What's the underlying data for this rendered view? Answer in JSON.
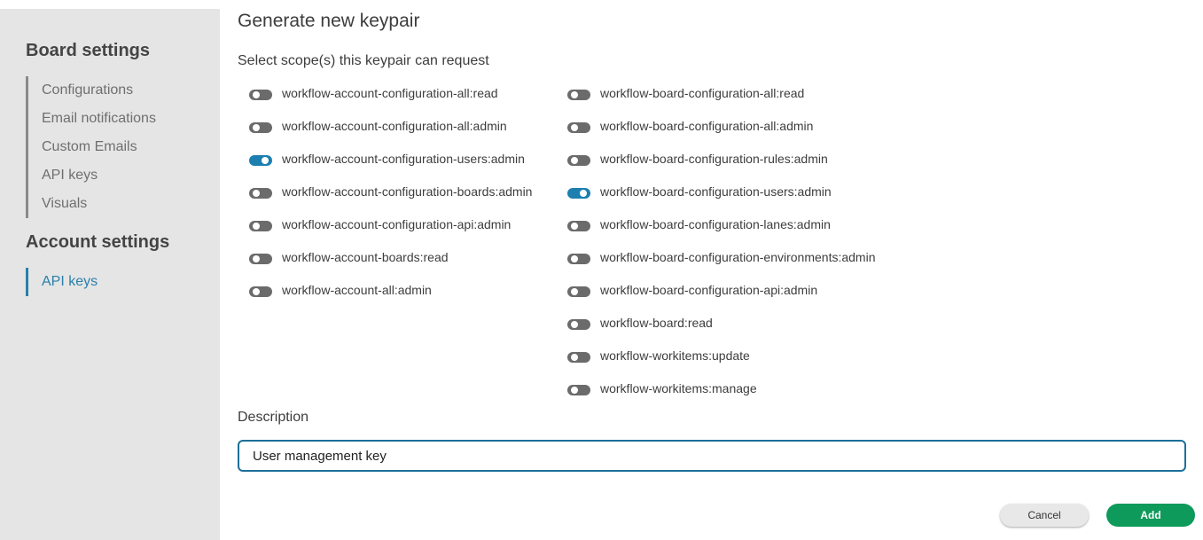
{
  "sidebar": {
    "board_heading": "Board settings",
    "board_items": [
      "Configurations",
      "Email notifications",
      "Custom Emails",
      "API keys",
      "Visuals"
    ],
    "account_heading": "Account settings",
    "account_items": [
      "API keys"
    ],
    "active_item": "API keys",
    "active_color": "#2a7fa8"
  },
  "main": {
    "title": "Generate new keypair",
    "scope_label": "Select scope(s) this keypair can request",
    "scopes_left": [
      {
        "name": "workflow-account-configuration-all:read",
        "enabled": false
      },
      {
        "name": "workflow-account-configuration-all:admin",
        "enabled": false
      },
      {
        "name": "workflow-account-configuration-users:admin",
        "enabled": true
      },
      {
        "name": "workflow-account-configuration-boards:admin",
        "enabled": false
      },
      {
        "name": "workflow-account-configuration-api:admin",
        "enabled": false
      },
      {
        "name": "workflow-account-boards:read",
        "enabled": false
      },
      {
        "name": "workflow-account-all:admin",
        "enabled": false
      }
    ],
    "scopes_right": [
      {
        "name": "workflow-board-configuration-all:read",
        "enabled": false
      },
      {
        "name": "workflow-board-configuration-all:admin",
        "enabled": false
      },
      {
        "name": "workflow-board-configuration-rules:admin",
        "enabled": false
      },
      {
        "name": "workflow-board-configuration-users:admin",
        "enabled": true
      },
      {
        "name": "workflow-board-configuration-lanes:admin",
        "enabled": false
      },
      {
        "name": "workflow-board-configuration-environments:admin",
        "enabled": false
      },
      {
        "name": "workflow-board-configuration-api:admin",
        "enabled": false
      },
      {
        "name": "workflow-board:read",
        "enabled": false
      },
      {
        "name": "workflow-workitems:update",
        "enabled": false
      },
      {
        "name": "workflow-workitems:manage",
        "enabled": false
      }
    ],
    "description_label": "Description",
    "description_value": "User management key",
    "cancel_label": "Cancel",
    "add_label": "Add"
  },
  "colors": {
    "toggle_on": "#1c7fb0",
    "toggle_off": "#6b6b6b",
    "add_button": "#0e9a5a",
    "input_border": "#1c6f99"
  }
}
